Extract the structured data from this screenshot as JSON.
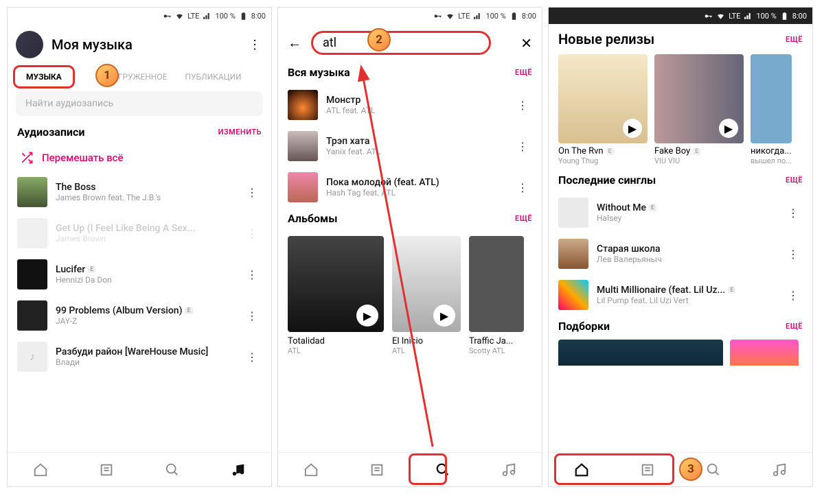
{
  "status": {
    "signal": "LTE",
    "battery": "100 %",
    "time": "8:00"
  },
  "p1": {
    "title": "Моя музыка",
    "tabs": [
      "МУЗЫКА",
      "ЗАГРУЖЕННОЕ",
      "ПУБЛИКАЦИИ"
    ],
    "search_placeholder": "Найти аудиозапись",
    "section": "Аудиозаписи",
    "edit": "ИЗМЕНИТЬ",
    "shuffle": "Перемешать всё",
    "tracks": [
      {
        "name": "The Boss",
        "artist": "James Brown feat. The J.B.'s"
      },
      {
        "name": "Get Up (I Feel Like Being A Sex...",
        "artist": "James Brown",
        "faded": true
      },
      {
        "name": "Lucifer",
        "artist": "Hennizi Da Don",
        "e": true
      },
      {
        "name": "99 Problems (Album Version)",
        "artist": "JAY-Z",
        "e": true
      },
      {
        "name": "Разбуди район [WareHouse Music]",
        "artist": "Влади"
      }
    ]
  },
  "p2": {
    "query": "atl",
    "all_music": "Вся музыка",
    "more": "ЕЩЁ",
    "tracks": [
      {
        "name": "Монстр",
        "artist": "ATL feat. ATL"
      },
      {
        "name": "Трэп хата",
        "artist": "Yanix feat. ATL"
      },
      {
        "name": "Пока молодой (feat. ATL)",
        "artist": "Hash Tag feat. ATL"
      }
    ],
    "albums_head": "Альбомы",
    "albums": [
      {
        "name": "Totalidad",
        "artist": "ATL"
      },
      {
        "name": "El Inicio",
        "artist": "ATL"
      },
      {
        "name": "Traffic Ja...",
        "artist": "Scotty ATL"
      }
    ]
  },
  "p3": {
    "releases_head": "Новые релизы",
    "more": "ЕЩЁ",
    "releases": [
      {
        "name": "On The Rvn",
        "artist": "Young Thug",
        "e": true
      },
      {
        "name": "Fake Boy",
        "artist": "VIU VIU",
        "e": true
      },
      {
        "name": "никогда...",
        "artist": "вышел по..."
      }
    ],
    "singles_head": "Последние синглы",
    "singles": [
      {
        "name": "Without Me",
        "artist": "Halsey",
        "e": true
      },
      {
        "name": "Старая школа",
        "artist": "Лев Валерьяныч"
      },
      {
        "name": "Multi Millionaire (feat. Lil Uz...",
        "artist": "Lil Pump feat. Lil Uzi Vert",
        "e": true
      }
    ],
    "collections_head": "Подборки"
  },
  "badges": {
    "b1": "1",
    "b2": "2",
    "b3": "3"
  }
}
